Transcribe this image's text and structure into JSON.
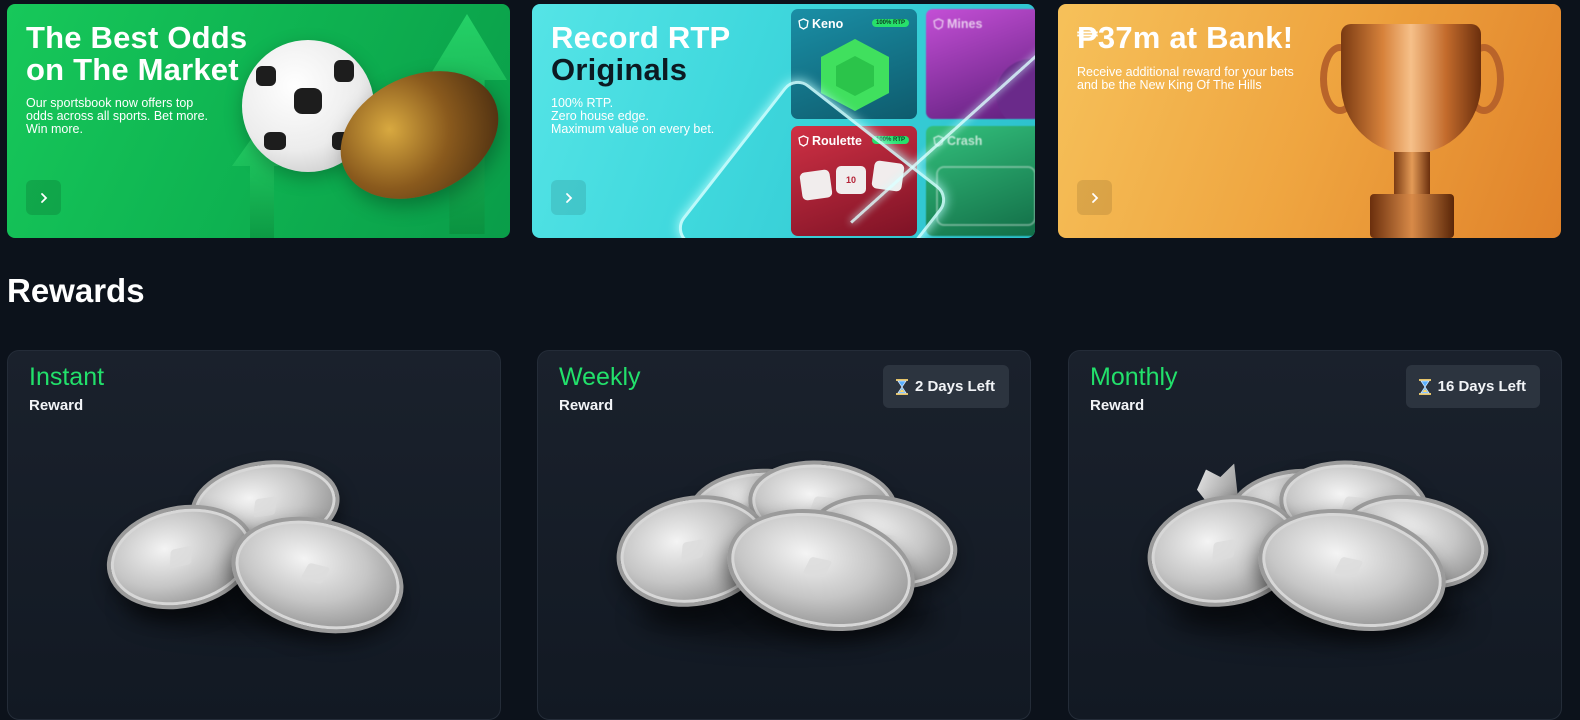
{
  "banners": [
    {
      "title_line1": "The Best Odds",
      "title_line2": "on The Market",
      "description": "Our sportsbook now offers top odds across all sports. Bet more. Win more.",
      "bg_color": "#13c157"
    },
    {
      "title_line1": "Record RTP",
      "title_line2": "Originals",
      "description_lines": [
        "100% RTP.",
        "Zero house edge.",
        "Maximum value on every bet."
      ],
      "tiles": [
        {
          "label": "Keno",
          "badge": "100% RTP"
        },
        {
          "label": "Mines"
        },
        {
          "label": "Roulette",
          "badge": "100% RTP",
          "dice_value": "10"
        },
        {
          "label": "Crash"
        }
      ],
      "bg_color": "#46dcdf"
    },
    {
      "title": "₱37m at Bank!",
      "description": "Receive additional reward for your bets and be the New King Of The Hills",
      "bg_color": "#f0a842"
    }
  ],
  "rewards": {
    "title": "Rewards",
    "accent_color": "#22e06b",
    "cards": [
      {
        "type": "Instant",
        "subtitle": "Reward"
      },
      {
        "type": "Weekly",
        "subtitle": "Reward",
        "timer": "2 Days Left"
      },
      {
        "type": "Monthly",
        "subtitle": "Reward",
        "timer": "16 Days Left"
      }
    ]
  },
  "icons": {
    "banner_next": "chevron-right-icon",
    "timer": "hourglass-icon",
    "tile_logo": "shield-logo-icon"
  }
}
